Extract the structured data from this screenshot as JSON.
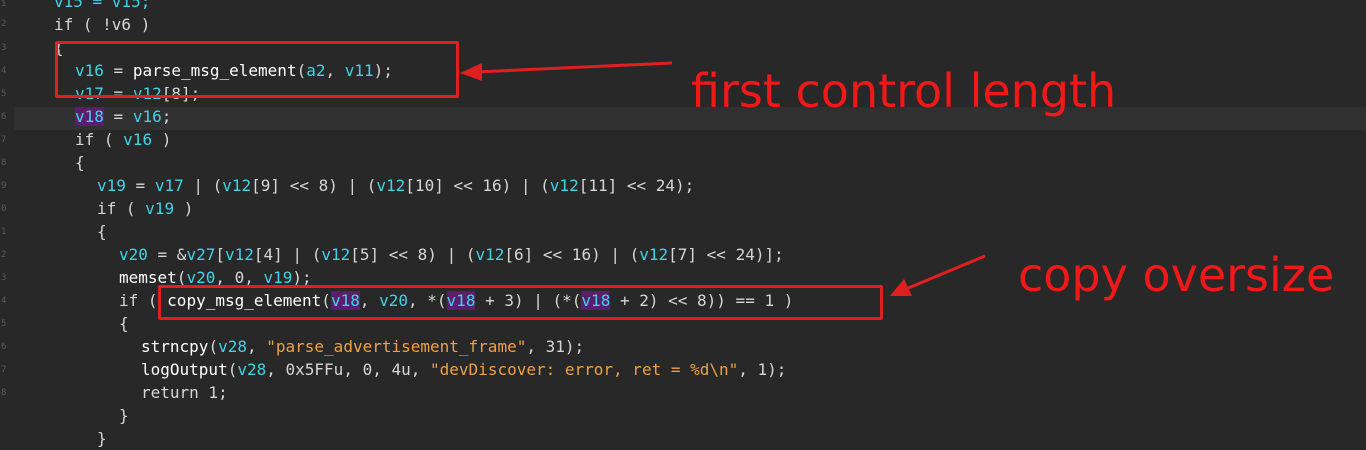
{
  "line_numbers": [
    "1",
    "2",
    "3",
    "4",
    "5",
    "6",
    "7",
    "8",
    "9",
    "0",
    "1",
    "2",
    "3",
    "4",
    "5",
    "6",
    "7",
    "8"
  ],
  "code": {
    "l1": [
      "v15 = v15;"
    ],
    "l2": [
      "if ( !v6 )"
    ],
    "l3": "{",
    "l4": [
      "v16",
      " = ",
      "parse_msg_element",
      "(",
      "a2",
      ", ",
      "v11",
      ");"
    ],
    "l5": [
      "v17",
      " = ",
      "v12",
      "[8];"
    ],
    "l6": [
      "v18",
      " = ",
      "v16",
      ";"
    ],
    "l7": [
      "if ( ",
      "v16",
      " )"
    ],
    "l8": "{",
    "l9": [
      "v19",
      " = ",
      "v17",
      " | (",
      "v12",
      "[9] << 8) | (",
      "v12",
      "[10] << 16) | (",
      "v12",
      "[11] << 24);"
    ],
    "l10": [
      "if ( ",
      "v19",
      " )"
    ],
    "l11": "{",
    "l12": [
      "v20",
      " = &",
      "v27",
      "[",
      "v12",
      "[4] | (",
      "v12",
      "[5] << 8) | (",
      "v12",
      "[6] << 16) | (",
      "v12",
      "[7] << 24)];"
    ],
    "l13": [
      "memset",
      "(",
      "v20",
      ", 0, ",
      "v19",
      ");"
    ],
    "l14": [
      "if ( ",
      "copy_msg_element",
      "(",
      "v18",
      ", ",
      "v20",
      ", *(",
      "v18",
      " + 3) | (*(",
      "v18",
      " + 2) << 8)) == 1 )"
    ],
    "l15": "{",
    "l16": [
      "strncpy",
      "(",
      "v28",
      ", ",
      "\"parse_advertisement_frame\"",
      ", 31);"
    ],
    "l17": [
      "logOutput",
      "(",
      "v28",
      ", 0x5FFu, 0, 4u, ",
      "\"devDiscover: error, ret = %d\\n\"",
      ", 1);"
    ],
    "l18": "return 1;",
    "l19": "}",
    "l20": "}"
  },
  "annotations": {
    "first": "first control length",
    "second": "copy oversize"
  },
  "colors": {
    "background": "#282828",
    "variable": "#3fd3e6",
    "string": "#f0a042",
    "annotation": "#e02020",
    "selection": "#5a1e6e"
  }
}
